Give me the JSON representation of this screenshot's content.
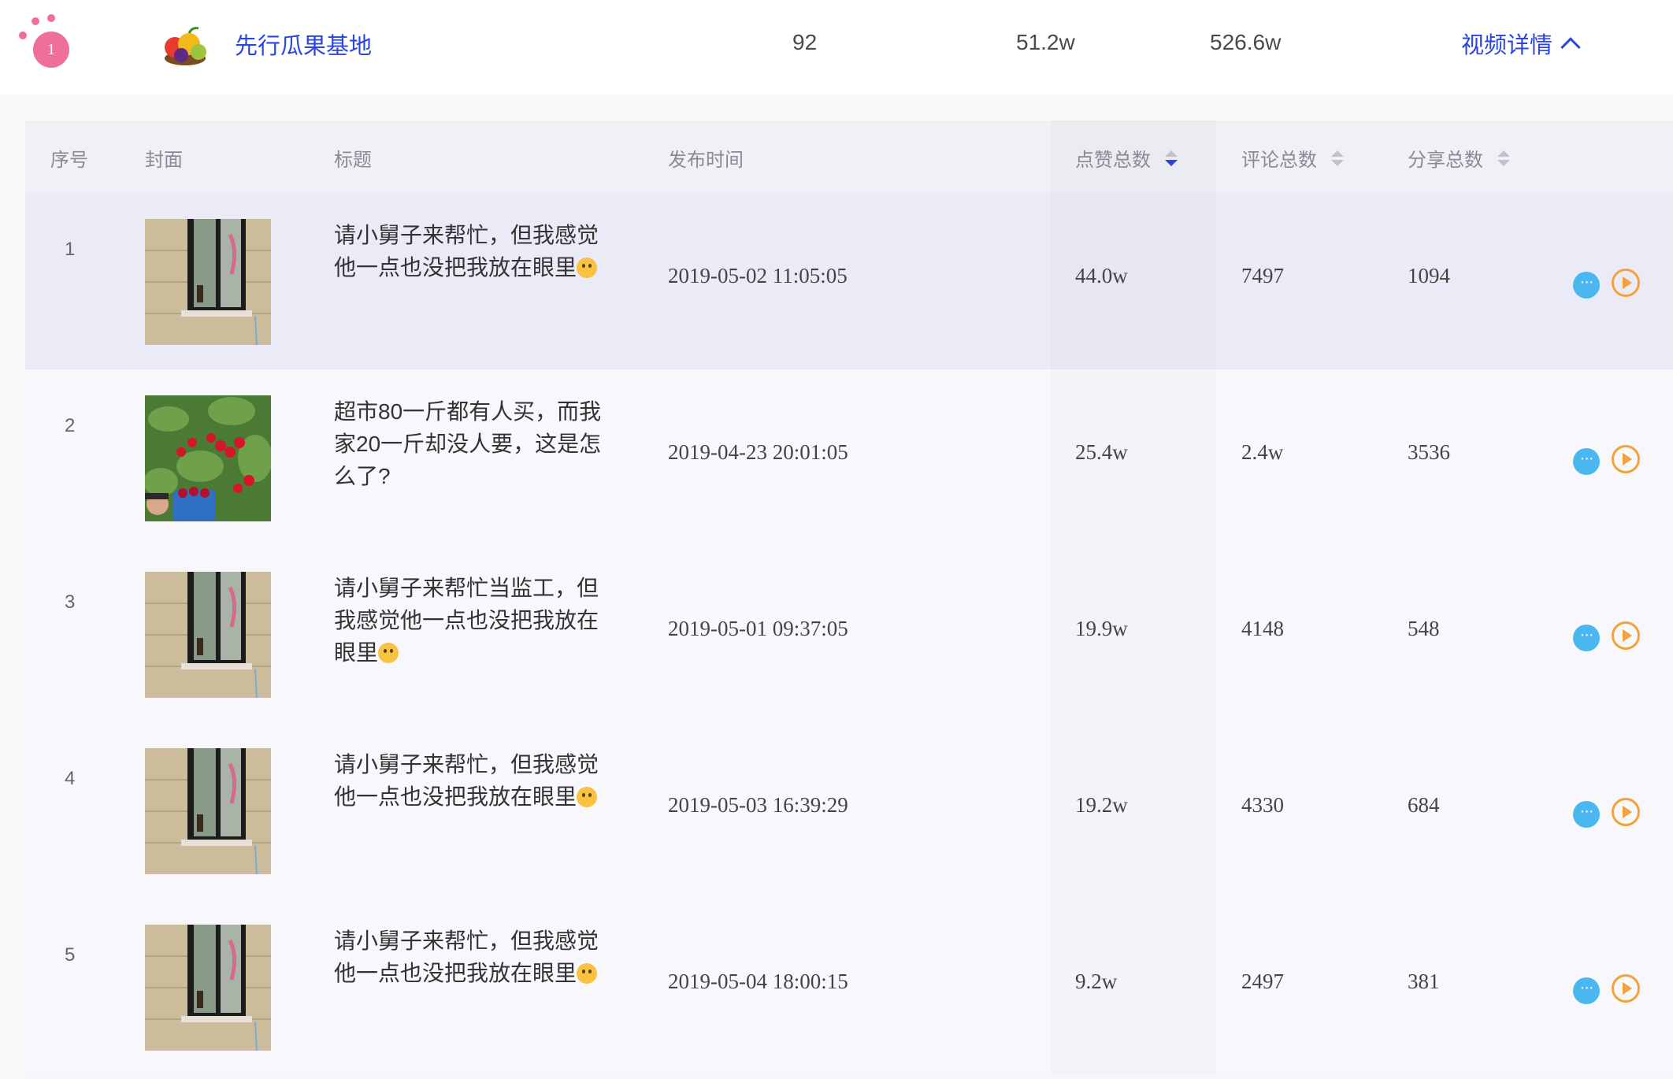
{
  "summary": {
    "rank": "1",
    "name": "先行瓜果基地",
    "video_count": "92",
    "likes": "51.2w",
    "fans": "526.6w",
    "detail_label": "视频详情"
  },
  "table": {
    "headers": {
      "index": "序号",
      "cover": "封面",
      "title": "标题",
      "date": "发布时间",
      "likes": "点赞总数",
      "comments": "评论总数",
      "shares": "分享总数"
    },
    "rows": [
      {
        "index": "1",
        "title": "请小舅子来帮忙，但我感觉他一点也没把我放在眼里",
        "cover": "window",
        "date": "2019-05-02 11:05:05",
        "likes": "44.0w",
        "comments": "7497",
        "shares": "1094",
        "more_icon": "···"
      },
      {
        "index": "2",
        "title": "超市80一斤都有人买，而我家20一斤却没人要，这是怎么了?",
        "cover": "cherries",
        "date": "2019-04-23 20:01:05",
        "likes": "25.4w",
        "comments": "2.4w",
        "shares": "3536",
        "more_icon": "···"
      },
      {
        "index": "3",
        "title": "请小舅子来帮忙当监工，但我感觉他一点也没把我放在眼里",
        "cover": "window",
        "date": "2019-05-01 09:37:05",
        "likes": "19.9w",
        "comments": "4148",
        "shares": "548",
        "more_icon": "···"
      },
      {
        "index": "4",
        "title": "请小舅子来帮忙，但我感觉他一点也没把我放在眼里",
        "cover": "window",
        "date": "2019-05-03 16:39:29",
        "likes": "19.2w",
        "comments": "4330",
        "shares": "684",
        "more_icon": "···"
      },
      {
        "index": "5",
        "title": "请小舅子来帮忙，但我感觉他一点也没把我放在眼里",
        "cover": "window",
        "date": "2019-05-04 18:00:15",
        "likes": "9.2w",
        "comments": "2497",
        "shares": "381",
        "more_icon": "···"
      }
    ]
  },
  "colors": {
    "accent": "#2b45e0",
    "rank_badge": "#f06e9c",
    "more_button": "#4ab7ee",
    "play_button": "#f5a03a",
    "active_row": "#ebebf8"
  },
  "icons": [
    "crown-rank-icon",
    "fruit-basket-logo",
    "chevron-up-icon",
    "sort-icon",
    "more-icon",
    "play-icon",
    "thinking-emoji-icon"
  ]
}
